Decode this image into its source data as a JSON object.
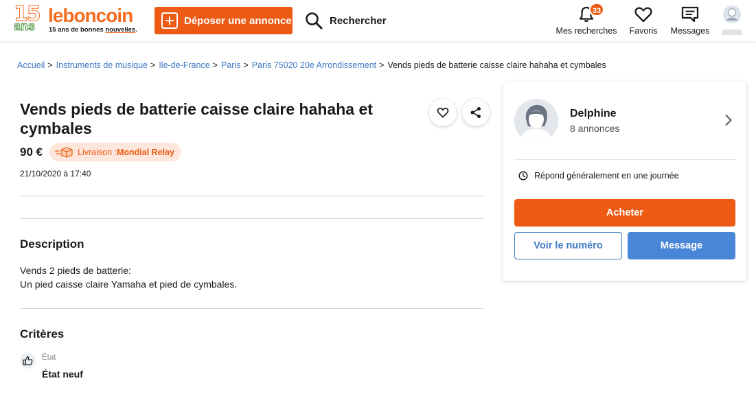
{
  "header": {
    "logo": {
      "number": "15",
      "ans": "ans",
      "wordmark": "leboncoin",
      "tagline_prefix": "15 ans de bonnes ",
      "tagline_highlight": "nouvelles",
      "tagline_suffix": "."
    },
    "post_button_label": "Déposer une annonce",
    "search_label": "Rechercher",
    "nav": {
      "saved_searches": {
        "label": "Mes recherches",
        "badge": "33",
        "icon": "bell-icon"
      },
      "favorites": {
        "label": "Favoris",
        "icon": "heart-icon"
      },
      "messages": {
        "label": "Messages",
        "icon": "message-icon"
      },
      "account": {
        "icon": "user-avatar-icon"
      }
    }
  },
  "breadcrumb": {
    "links": [
      "Accueil",
      "Instruments de musique",
      "Ile-de-France",
      "Paris",
      "Paris 75020 20e Arrondissement"
    ],
    "separator": ">",
    "current": "Vends pieds de batterie caisse claire hahaha et cymbales"
  },
  "ad": {
    "title": "Vends pieds de batterie caisse claire hahaha et cymbales",
    "price": "90 €",
    "delivery_prefix": "Livraison : ",
    "delivery_carrier": "Mondial Relay",
    "date": "21/10/2020 à 17:40"
  },
  "description": {
    "title": "Description",
    "lines": [
      "Vends 2 pieds de batterie:",
      "Un pied caisse claire Yamaha et pied de cymbales."
    ]
  },
  "criteria": {
    "title": "Critères",
    "items": [
      {
        "label": "État",
        "value": "État neuf",
        "icon": "thumbs-up-icon"
      }
    ]
  },
  "seller": {
    "name": "Delphine",
    "ads_count": "8 annonces",
    "response_time": "Répond généralement en une journée",
    "buy_label": "Acheter",
    "phone_label": "Voir le numéro",
    "message_label": "Message"
  },
  "colors": {
    "brand_orange": "#ec5a13",
    "link_blue": "#3f79c5",
    "message_blue": "#4a86d8"
  }
}
